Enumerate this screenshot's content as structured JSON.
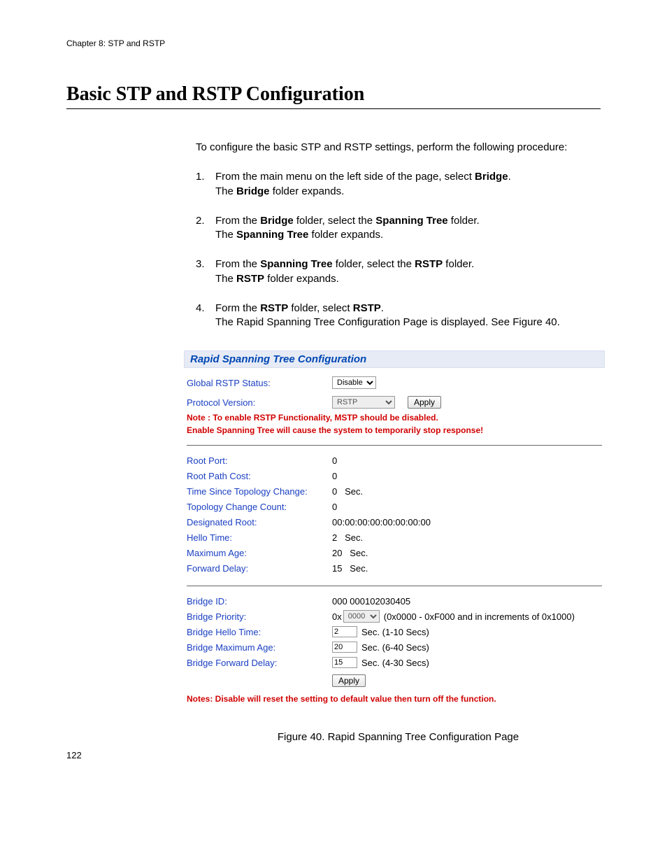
{
  "header": {
    "chapter": "Chapter 8: STP and RSTP"
  },
  "title": "Basic STP and RSTP Configuration",
  "intro": "To configure the basic STP and RSTP settings, perform the following procedure:",
  "steps": [
    {
      "num": "1.",
      "line1a": "From the main menu on the left side of the page, select ",
      "line1b": "Bridge",
      "line1c": ".",
      "line2a": "The ",
      "line2b": "Bridge",
      "line2c": " folder expands."
    },
    {
      "num": "2.",
      "line1a": "From the ",
      "line1b": "Bridge",
      "line1c": " folder, select the ",
      "line1d": "Spanning Tree",
      "line1e": " folder.",
      "line2a": "The ",
      "line2b": "Spanning Tree",
      "line2c": " folder expands."
    },
    {
      "num": "3.",
      "line1a": "From the ",
      "line1b": "Spanning Tree",
      "line1c": " folder, select the ",
      "line1d": "RSTP",
      "line1e": " folder.",
      "line2a": "The ",
      "line2b": "RSTP",
      "line2c": " folder expands."
    },
    {
      "num": "4.",
      "line1a": "Form the ",
      "line1b": "RSTP",
      "line1c": " folder, select ",
      "line1d": "RSTP",
      "line1e": ".",
      "line2": "The Rapid Spanning Tree Configuration Page is displayed. See Figure 40."
    }
  ],
  "panel": {
    "title": "Rapid Spanning Tree Configuration",
    "global_status_label": "Global RSTP Status:",
    "global_status_value": "Disable",
    "protocol_label": "Protocol Version:",
    "protocol_value": "RSTP",
    "apply_label": "Apply",
    "note1": "Note : To enable RSTP Functionality, MSTP should be disabled.",
    "note2": "Enable Spanning Tree will cause the system to temporarily stop response!",
    "root_port_label": "Root Port:",
    "root_port_value": "0",
    "root_path_cost_label": "Root Path Cost:",
    "root_path_cost_value": "0",
    "time_since_tc_label": "Time Since Topology Change:",
    "time_since_tc_value": "0   Sec.",
    "tc_count_label": "Topology Change Count:",
    "tc_count_value": "0",
    "designated_root_label": "Designated Root:",
    "designated_root_value": "00:00:00:00:00:00:00:00",
    "hello_time_label": "Hello Time:",
    "hello_time_value": "2   Sec.",
    "max_age_label": "Maximum Age:",
    "max_age_value": "20   Sec.",
    "forward_delay_label": "Forward Delay:",
    "forward_delay_value": "15   Sec.",
    "bridge_id_label": "Bridge ID:",
    "bridge_id_value": "000 000102030405",
    "bridge_priority_label": "Bridge Priority:",
    "bridge_priority_prefix": "0x",
    "bridge_priority_value": "0000",
    "bridge_priority_hint": "(0x0000 - 0xF000 and in increments of 0x1000)",
    "bridge_hello_label": "Bridge Hello Time:",
    "bridge_hello_value": "2",
    "bridge_hello_hint": "Sec. (1-10 Secs)",
    "bridge_max_age_label": "Bridge Maximum Age:",
    "bridge_max_age_value": "20",
    "bridge_max_age_hint": "Sec. (6-40 Secs)",
    "bridge_fwd_delay_label": "Bridge Forward Delay:",
    "bridge_fwd_delay_value": "15",
    "bridge_fwd_delay_hint": "Sec. (4-30 Secs)",
    "apply2_label": "Apply",
    "footer_note": "Notes: Disable will reset the setting to default value then turn off the function."
  },
  "caption": "Figure 40. Rapid Spanning Tree Configuration Page",
  "page_number": "122"
}
